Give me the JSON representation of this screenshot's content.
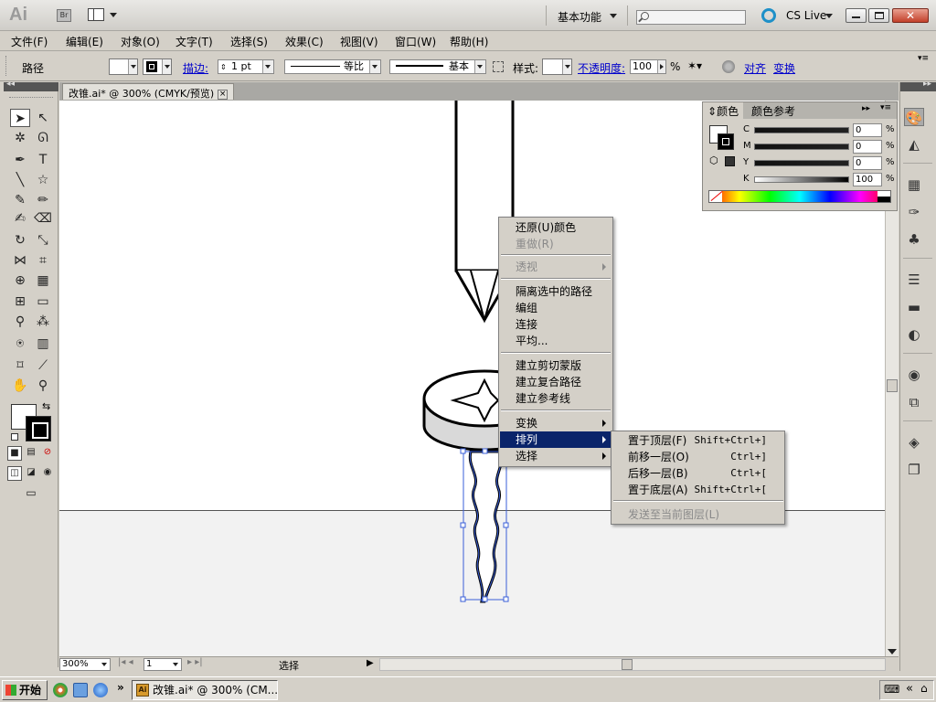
{
  "app": {
    "logo": "Ai",
    "bridge": "Br",
    "workspace": "基本功能",
    "cslive": "CS Live",
    "close": "✕"
  },
  "menubar": [
    "文件(F)",
    "编辑(E)",
    "对象(O)",
    "文字(T)",
    "选择(S)",
    "效果(C)",
    "视图(V)",
    "窗口(W)",
    "帮助(H)"
  ],
  "control": {
    "object_label": "路径",
    "stroke_link": "描边:",
    "stroke_weight": "1 pt",
    "profile_label": "等比",
    "brush_label": "基本",
    "style_label": "样式:",
    "opacity_link": "不透明度:",
    "opacity_value": "100",
    "opacity_unit": "%",
    "align_link": "对齐",
    "transform_link": "变换"
  },
  "document": {
    "tab_title": "改锥.ai* @ 300% (CMYK/预览)",
    "zoom": "300%",
    "artboard": "1",
    "status": "选择"
  },
  "color_panel": {
    "tab_color": "颜色",
    "tab_guide": "颜色参考",
    "channels": [
      {
        "label": "C",
        "value": "0",
        "unit": "%"
      },
      {
        "label": "M",
        "value": "0",
        "unit": "%"
      },
      {
        "label": "Y",
        "value": "0",
        "unit": "%"
      },
      {
        "label": "K",
        "value": "100",
        "unit": "%"
      }
    ]
  },
  "context_menu": {
    "items": [
      {
        "label": "还原(U)颜色",
        "disabled": false
      },
      {
        "label": "重做(R)",
        "disabled": true
      },
      {
        "label": "透视",
        "disabled": true,
        "submenu": true
      },
      {
        "label": "隔离选中的路径",
        "disabled": false
      },
      {
        "label": "编组",
        "disabled": false
      },
      {
        "label": "连接",
        "disabled": false
      },
      {
        "label": "平均...",
        "disabled": false
      },
      {
        "label": "建立剪切蒙版",
        "disabled": false
      },
      {
        "label": "建立复合路径",
        "disabled": false
      },
      {
        "label": "建立参考线",
        "disabled": false
      },
      {
        "label": "变换",
        "disabled": false,
        "submenu": true
      },
      {
        "label": "排列",
        "disabled": false,
        "submenu": true,
        "highlighted": true
      },
      {
        "label": "选择",
        "disabled": false,
        "submenu": true
      }
    ]
  },
  "arrange_submenu": {
    "items": [
      {
        "label": "置于顶层(F)",
        "shortcut": "Shift+Ctrl+]"
      },
      {
        "label": "前移一层(O)",
        "shortcut": "Ctrl+]"
      },
      {
        "label": "后移一层(B)",
        "shortcut": "Ctrl+["
      },
      {
        "label": "置于底层(A)",
        "shortcut": "Shift+Ctrl+["
      },
      {
        "label": "发送至当前图层(L)",
        "shortcut": "",
        "disabled": true
      }
    ]
  },
  "taskbar": {
    "start": "开始",
    "chevron": "»",
    "task_label": "改锥.ai* @ 300% (CM...",
    "task_icon": "Ai",
    "tray_chevron": "«"
  },
  "colors": {
    "menu_highlight": "#0a246a",
    "link": "#0000cc",
    "selection": "#3a5fd8"
  }
}
